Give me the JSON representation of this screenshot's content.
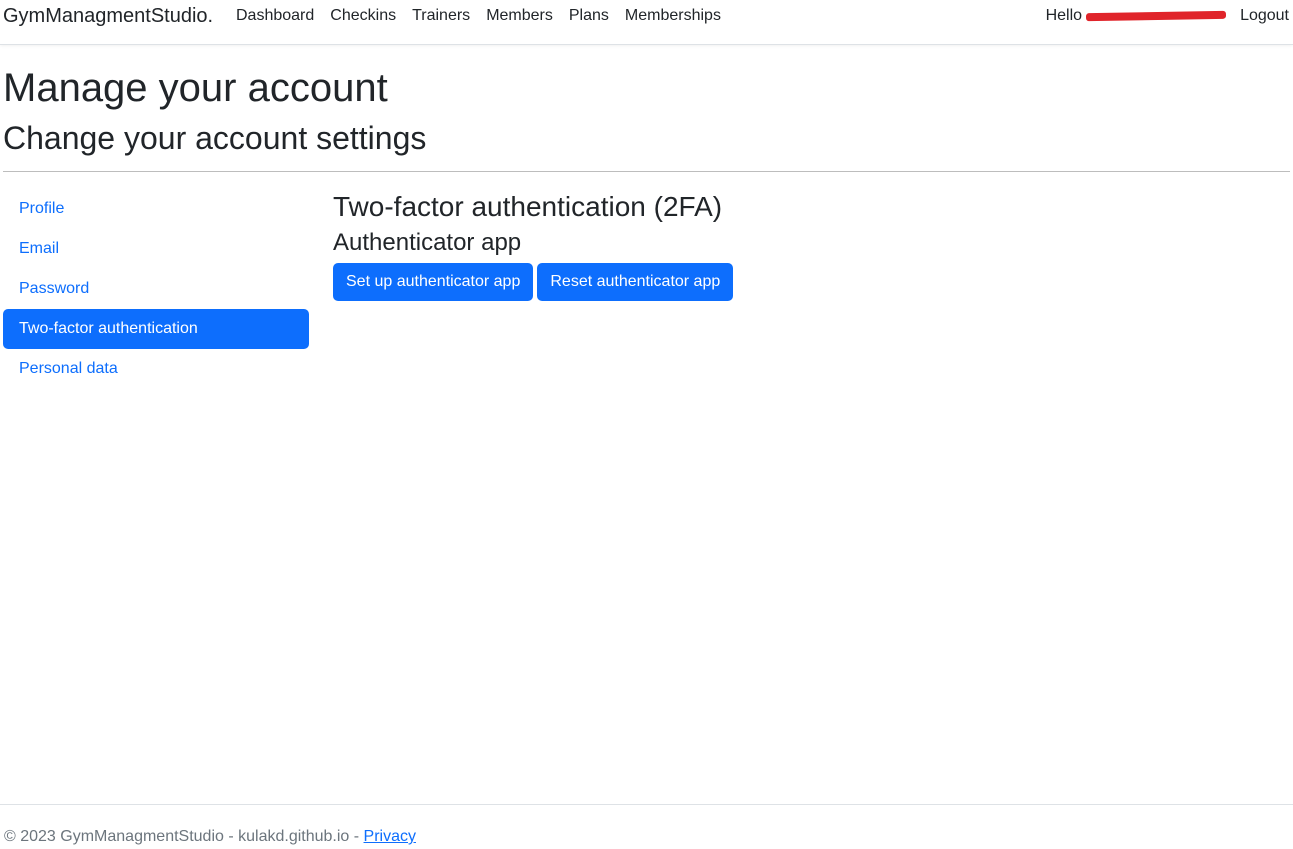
{
  "navbar": {
    "brand": "GymManagmentStudio.",
    "links": [
      "Dashboard",
      "Checkins",
      "Trainers",
      "Members",
      "Plans",
      "Memberships"
    ],
    "hello_prefix": "Hello",
    "logout_label": "Logout"
  },
  "page": {
    "title": "Manage your account",
    "subtitle": "Change your account settings"
  },
  "sidebar": {
    "items": [
      {
        "label": "Profile",
        "active": false
      },
      {
        "label": "Email",
        "active": false
      },
      {
        "label": "Password",
        "active": false
      },
      {
        "label": "Two-factor authentication",
        "active": true
      },
      {
        "label": "Personal data",
        "active": false
      }
    ]
  },
  "main": {
    "heading": "Two-factor authentication (2FA)",
    "subheading": "Authenticator app",
    "setup_button": "Set up authenticator app",
    "reset_button": "Reset authenticator app"
  },
  "footer": {
    "text": "© 2023 GymManagmentStudio - kulakd.github.io - ",
    "privacy_link": "Privacy"
  },
  "colors": {
    "primary": "#0d6efd",
    "redaction": "#e0242a"
  }
}
